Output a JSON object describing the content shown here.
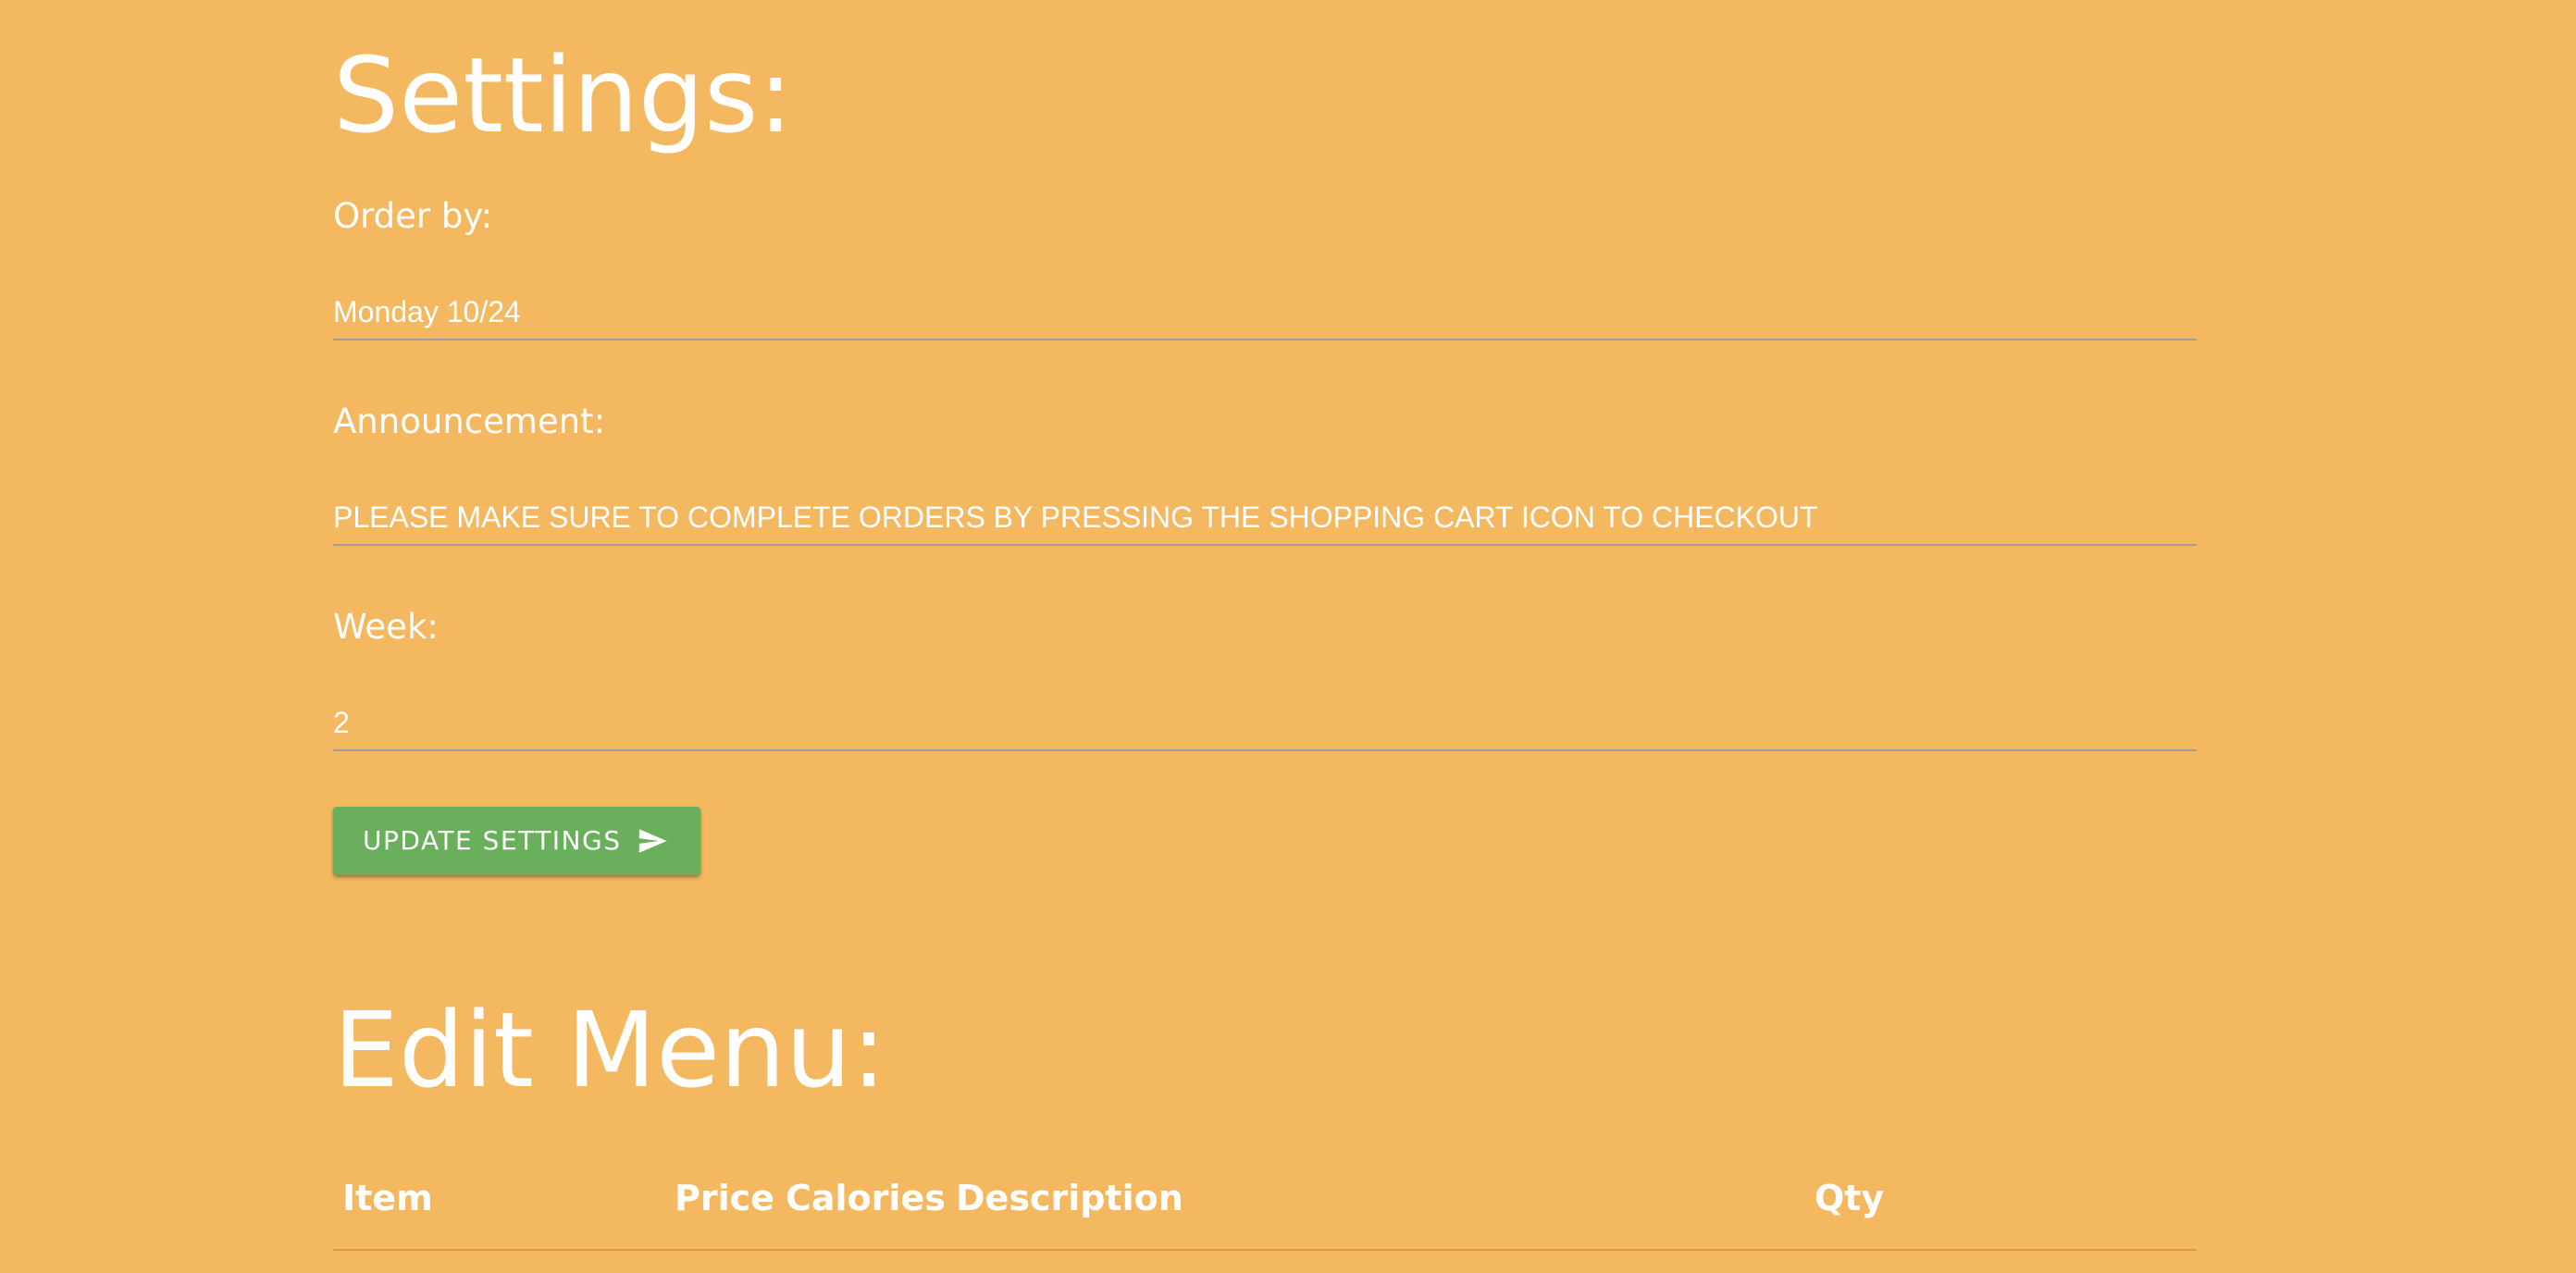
{
  "settings": {
    "title": "Settings:",
    "order_by": {
      "label": "Order by:",
      "value": "Monday 10/24"
    },
    "announcement": {
      "label": "Announcement:",
      "value": "PLEASE MAKE SURE TO COMPLETE ORDERS BY PRESSING THE SHOPPING CART ICON TO CHECKOUT"
    },
    "week": {
      "label": "Week:",
      "value": "2"
    },
    "update_button": {
      "label": "UPDATE SETTINGS",
      "icon": "send-icon"
    }
  },
  "menu": {
    "title": "Edit Menu:",
    "columns": [
      "Item",
      "Price",
      "Calories",
      "Description",
      "Qty"
    ]
  },
  "colors": {
    "background": "#f4b960",
    "button": "#6ab05c",
    "text": "#ffffff"
  }
}
